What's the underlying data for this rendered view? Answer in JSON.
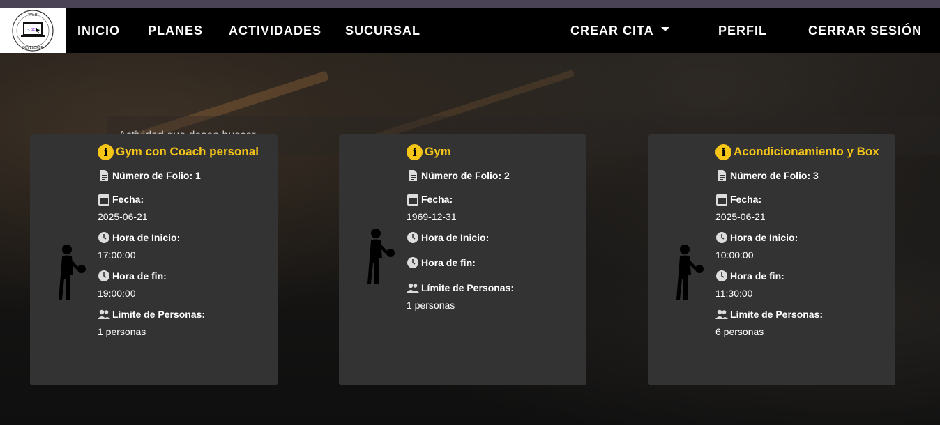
{
  "navbar": {
    "logo_alt": "Web Developer",
    "links": [
      "INICIO",
      "PLANES",
      "ACTIVIDADES",
      "SUCURSAL"
    ],
    "crear_cita": "CREAR CITA",
    "perfil": "PERFIL",
    "cerrar_sesion": "CERRAR SESIÓN"
  },
  "search": {
    "placeholder": "Actividad que desea buscar"
  },
  "labels": {
    "folio": "Número de Folio:",
    "fecha": "Fecha:",
    "hora_inicio": "Hora de Inicio:",
    "hora_fin": "Hora de fin:",
    "limite": "Límite de Personas:"
  },
  "cards": [
    {
      "title": "Gym con Coach personal",
      "folio": "1",
      "fecha": "2025-06-21",
      "hora_inicio": "17:00:00",
      "hora_fin": "19:00:00",
      "limite": "1 personas"
    },
    {
      "title": "Gym",
      "folio": "2",
      "fecha": "1969-12-31",
      "hora_inicio": "",
      "hora_fin": "",
      "limite": "1 personas"
    },
    {
      "title": "Acondicionamiento y Box",
      "folio": "3",
      "fecha": "2025-06-21",
      "hora_inicio": "10:00:00",
      "hora_fin": "11:30:00",
      "limite": "6 personas"
    }
  ],
  "colors": {
    "accent": "#f5c518",
    "card_bg": "#333333",
    "navbar_bg": "#000000",
    "top_strip": "#4a4255"
  }
}
